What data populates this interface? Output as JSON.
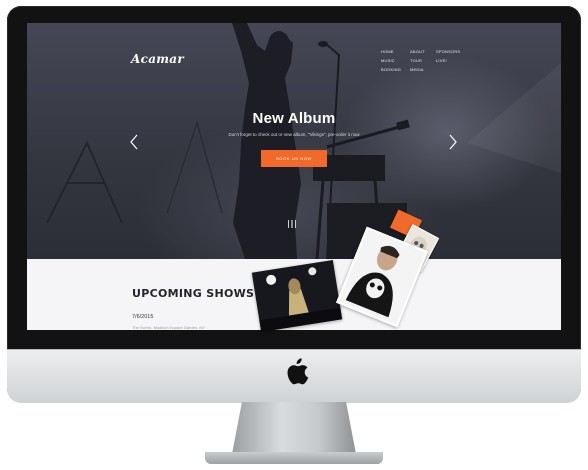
{
  "site": {
    "brand": "Acamar",
    "nav": [
      "HOME",
      "ABOUT",
      "SPONSORS",
      "MUSIC",
      "TOUR",
      "LIVE!",
      "BOOKING",
      "MEDIA"
    ]
  },
  "hero": {
    "title": "New Album",
    "subtitle": "Don't forget to check out or new album, \"Vikings\", pre-order it now",
    "button_label": "BOOK US NOW",
    "accent_color": "#f26a2a",
    "slide_indicator": "|||"
  },
  "upcoming": {
    "title": "UPCOMING SHOWS",
    "date": "7/6/2015",
    "venue": "The Scene, Madison Square Garden, NY"
  },
  "icons": {
    "prev": "chevron-left-icon",
    "next": "chevron-right-icon",
    "device_logo": "apple-icon"
  }
}
